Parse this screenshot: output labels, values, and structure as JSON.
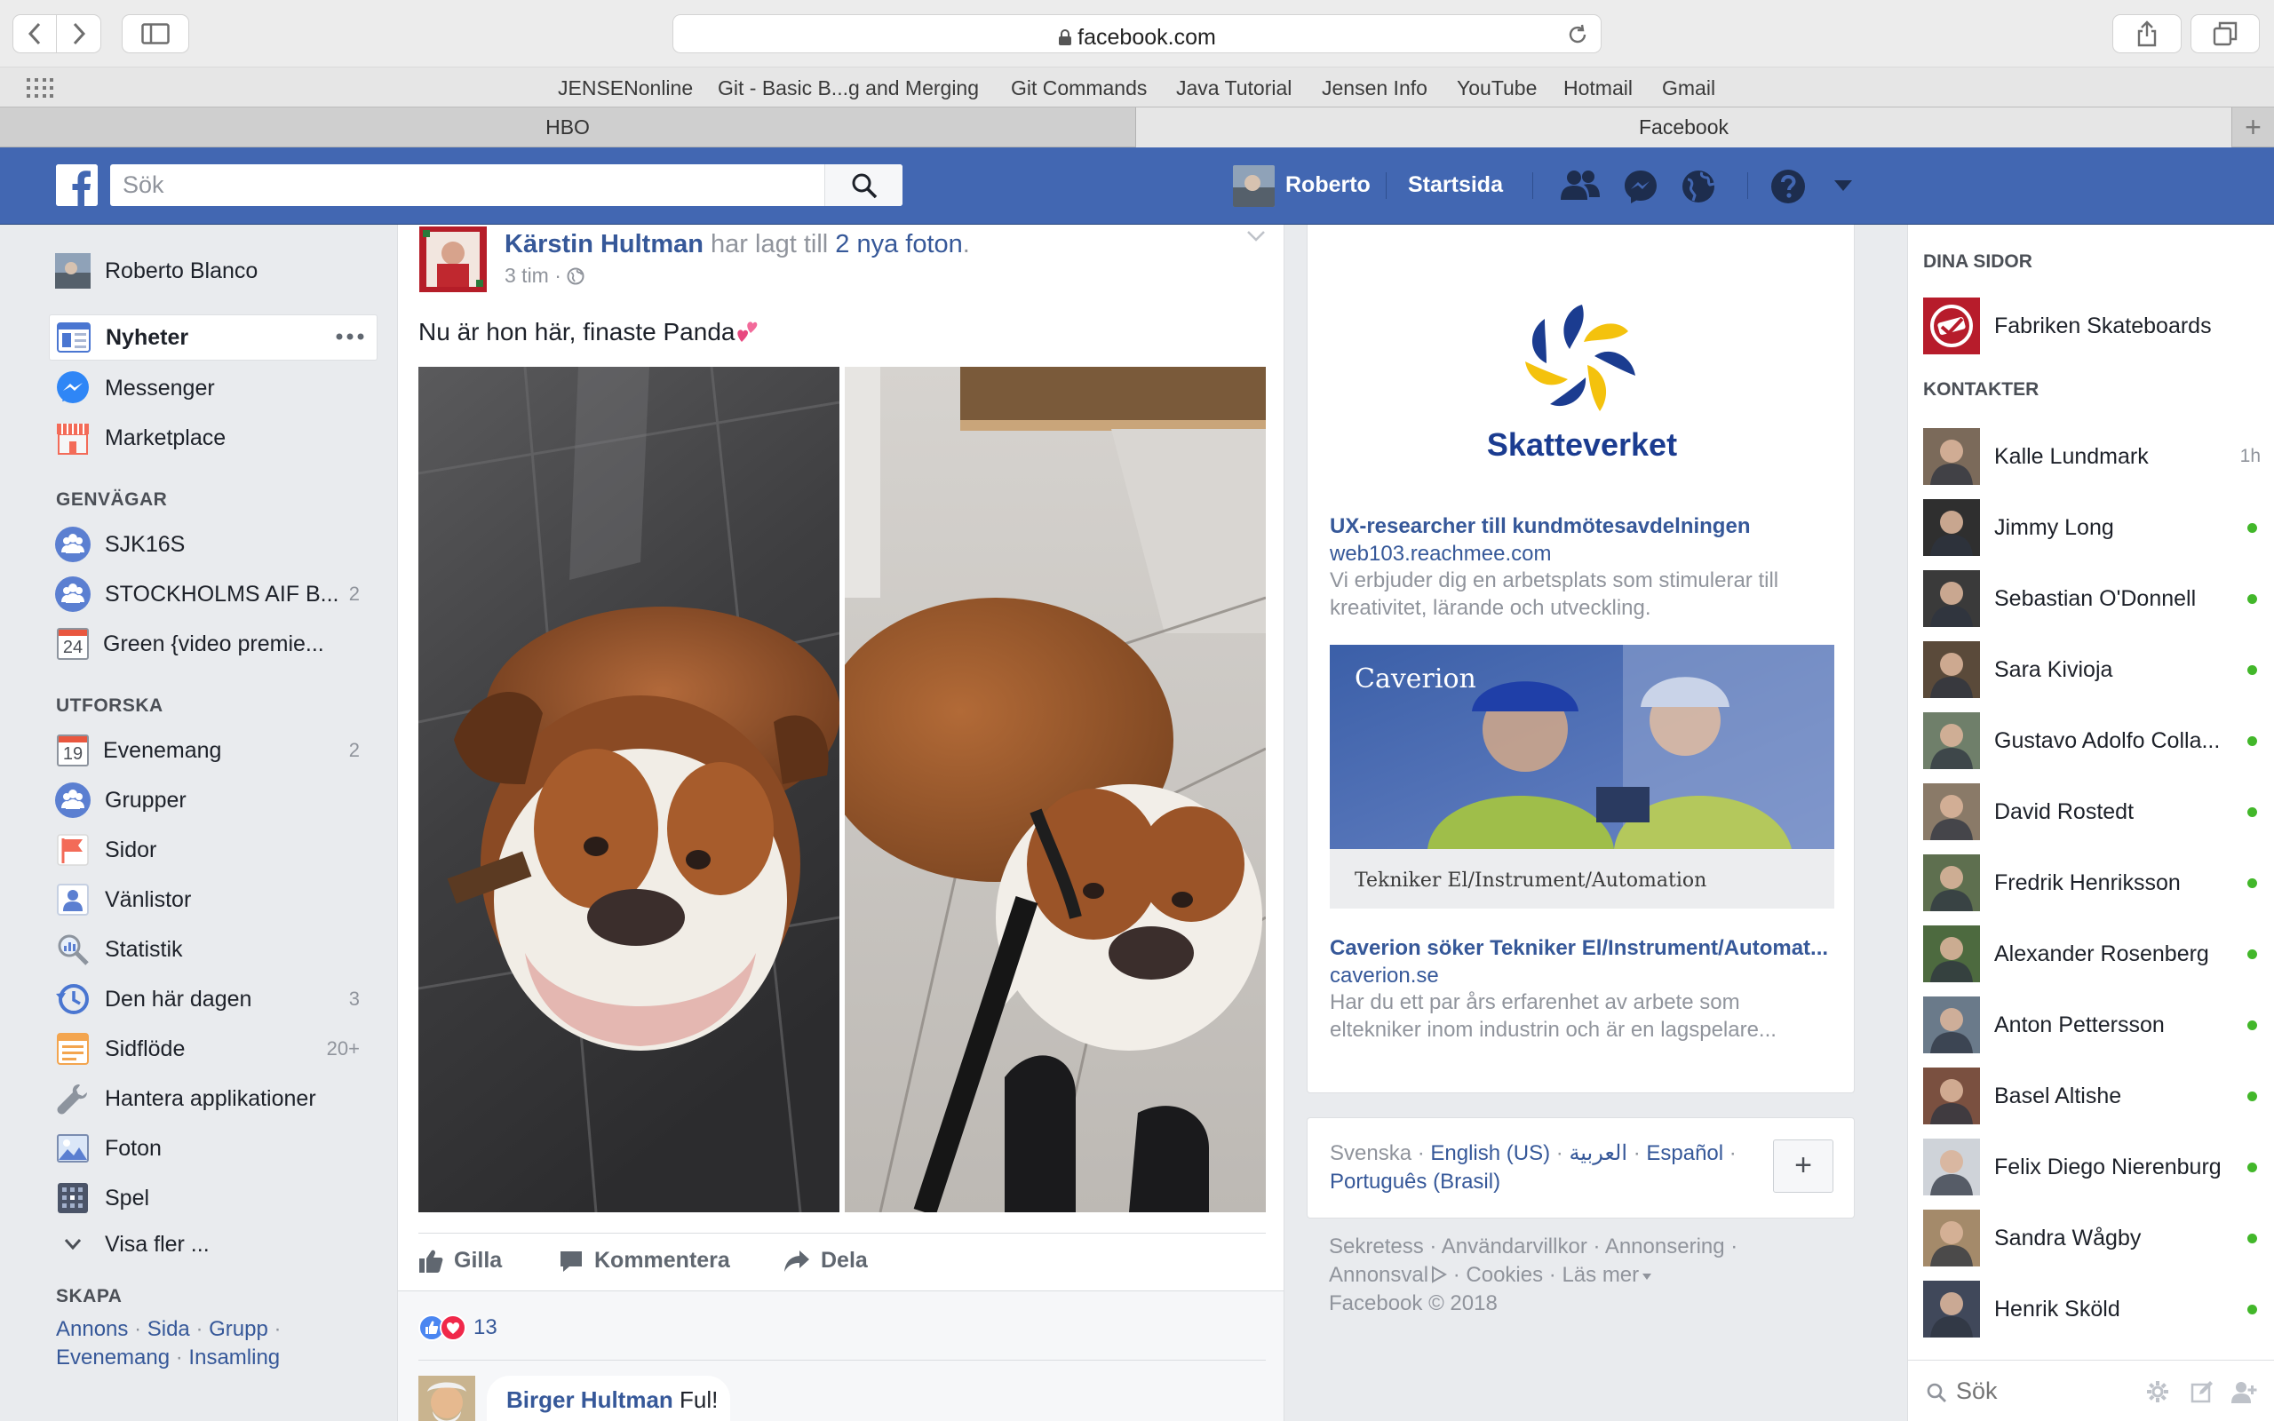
{
  "browser": {
    "url": "facebook.com",
    "bookmarks": [
      "JENSENonline",
      "Git - Basic B...g and Merging",
      "Git Commands",
      "Java Tutorial",
      "Jensen Info",
      "YouTube",
      "Hotmail",
      "Gmail"
    ],
    "tabs": [
      "HBO",
      "Facebook"
    ]
  },
  "fb": {
    "search_placeholder": "Sök",
    "user_short": "Roberto",
    "home": "Startsida",
    "brand_color": "#4267b2"
  },
  "leftnav": {
    "user": "Roberto Blanco",
    "main": [
      {
        "label": "Nyheter"
      },
      {
        "label": "Messenger"
      },
      {
        "label": "Marketplace"
      }
    ],
    "shortcuts_title": "GENVÄGAR",
    "shortcuts": [
      {
        "label": "SJK16S",
        "count": ""
      },
      {
        "label": "STOCKHOLMS AIF B...",
        "count": "2"
      },
      {
        "label": "Green {video premie...",
        "count": ""
      }
    ],
    "shortcut_date": "24",
    "explore_title": "UTFORSKA",
    "explore": [
      {
        "label": "Evenemang",
        "count": "2"
      },
      {
        "label": "Grupper",
        "count": ""
      },
      {
        "label": "Sidor",
        "count": ""
      },
      {
        "label": "Vänlistor",
        "count": ""
      },
      {
        "label": "Statistik",
        "count": ""
      },
      {
        "label": "Den här dagen",
        "count": "3"
      },
      {
        "label": "Sidflöde",
        "count": "20+"
      },
      {
        "label": "Hantera applikationer",
        "count": ""
      },
      {
        "label": "Foton",
        "count": ""
      },
      {
        "label": "Spel",
        "count": ""
      }
    ],
    "event_date": "19",
    "see_more": "Visa fler ...",
    "create_title": "SKAPA",
    "create_links": [
      "Annons",
      "Sida",
      "Grupp",
      "Evenemang",
      "Insamling"
    ]
  },
  "post": {
    "author": "Kärstin Hultman",
    "action": "har lagt till",
    "photos_link": "2 nya foton",
    "time": "3 tim",
    "text": "Nu är hon här, finaste Panda",
    "like": "Gilla",
    "comment": "Kommentera",
    "share": "Dela",
    "reactions": "13",
    "comment_author": "Birger Hultman",
    "comment_text": "Ful!"
  },
  "ads": [
    {
      "title": "UX-researcher till kundmötesavdelningen",
      "domain": "web103.reachmee.com",
      "desc": "Vi erbjuder dig en arbetsplats som stimulerar till kreativitet, lärande och utveckling.",
      "brand": "Skatteverket"
    },
    {
      "title": "Caverion söker Tekniker El/Instrument/Automat...",
      "domain": "caverion.se",
      "desc": "Har du ett par års erfarenhet av arbete som eltekniker inom industrin och är en lagspelare...",
      "brand": "Caverion",
      "caption": "Tekniker El/Instrument/Automation"
    }
  ],
  "languages": {
    "current": "Svenska",
    "others": [
      "English (US)",
      "العربية",
      "Español",
      "Português (Brasil)"
    ],
    "add": "+"
  },
  "footer": {
    "links": [
      "Sekretess",
      "Användarvillkor",
      "Annonsering",
      "Annonsval",
      "Cookies",
      "Läs mer"
    ],
    "copyright": "Facebook © 2018"
  },
  "chat": {
    "pages_title": "DINA SIDOR",
    "page": "Fabriken Skateboards",
    "contacts_title": "KONTAKTER",
    "contacts": [
      {
        "name": "Kalle Lundmark",
        "status": "1h"
      },
      {
        "name": "Jimmy Long",
        "status": "online"
      },
      {
        "name": "Sebastian O'Donnell",
        "status": "online"
      },
      {
        "name": "Sara Kivioja",
        "status": "online"
      },
      {
        "name": "Gustavo Adolfo Colla...",
        "status": "online"
      },
      {
        "name": "David Rostedt",
        "status": "online"
      },
      {
        "name": "Fredrik Henriksson",
        "status": "online"
      },
      {
        "name": "Alexander Rosenberg",
        "status": "online"
      },
      {
        "name": "Anton Pettersson",
        "status": "online"
      },
      {
        "name": "Basel Altishe",
        "status": "online"
      },
      {
        "name": "Felix Diego Nierenburg",
        "status": "online"
      },
      {
        "name": "Sandra Wågby",
        "status": "online"
      },
      {
        "name": "Henrik Sköld",
        "status": "online"
      }
    ],
    "search_placeholder": "Sök"
  }
}
